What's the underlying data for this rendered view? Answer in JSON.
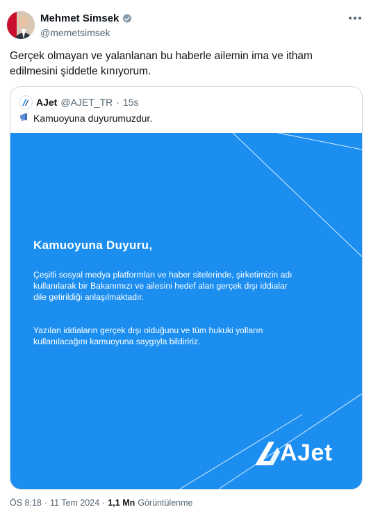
{
  "author": {
    "name": "Mehmet Simsek",
    "handle": "@memetsimsek"
  },
  "tweet": {
    "text": "Gerçek olmayan ve yalanlanan bu haberle ailemin ima ve itham edilmesini şiddetle kınıyorum."
  },
  "quote": {
    "name": "AJet",
    "handle": "@AJET_TR",
    "separator": "·",
    "time": "15s",
    "text": "Kamuoyuna duyurumuzdur.",
    "text_icon": "megaphone-icon",
    "card": {
      "title": "Kamuoyuna Duyuru,",
      "paragraph1": "Çeşitli sosyal medya platformları ve haber sitelerinde, şirketimizin adı kullanılarak bir Bakanımızı ve ailesini hedef alan gerçek dışı iddialar dile getirildiği anlaşılmaktadır.",
      "paragraph2": "Yazılan iddiaların gerçek dışı olduğunu ve tüm hukuki yolların kullanılacağını kamuoyuna saygıyla bildiririz.",
      "brand": "AJet",
      "background": "#1b8ef0"
    }
  },
  "meta": {
    "time": "ÖS 8:18",
    "dot1": "·",
    "date": "11 Tem 2024",
    "dot2": "·",
    "views": "1,1 Mn",
    "views_label": "Görüntülenme"
  },
  "colors": {
    "text": "#0f1419",
    "secondary": "#536471",
    "verified": "#829aab"
  }
}
